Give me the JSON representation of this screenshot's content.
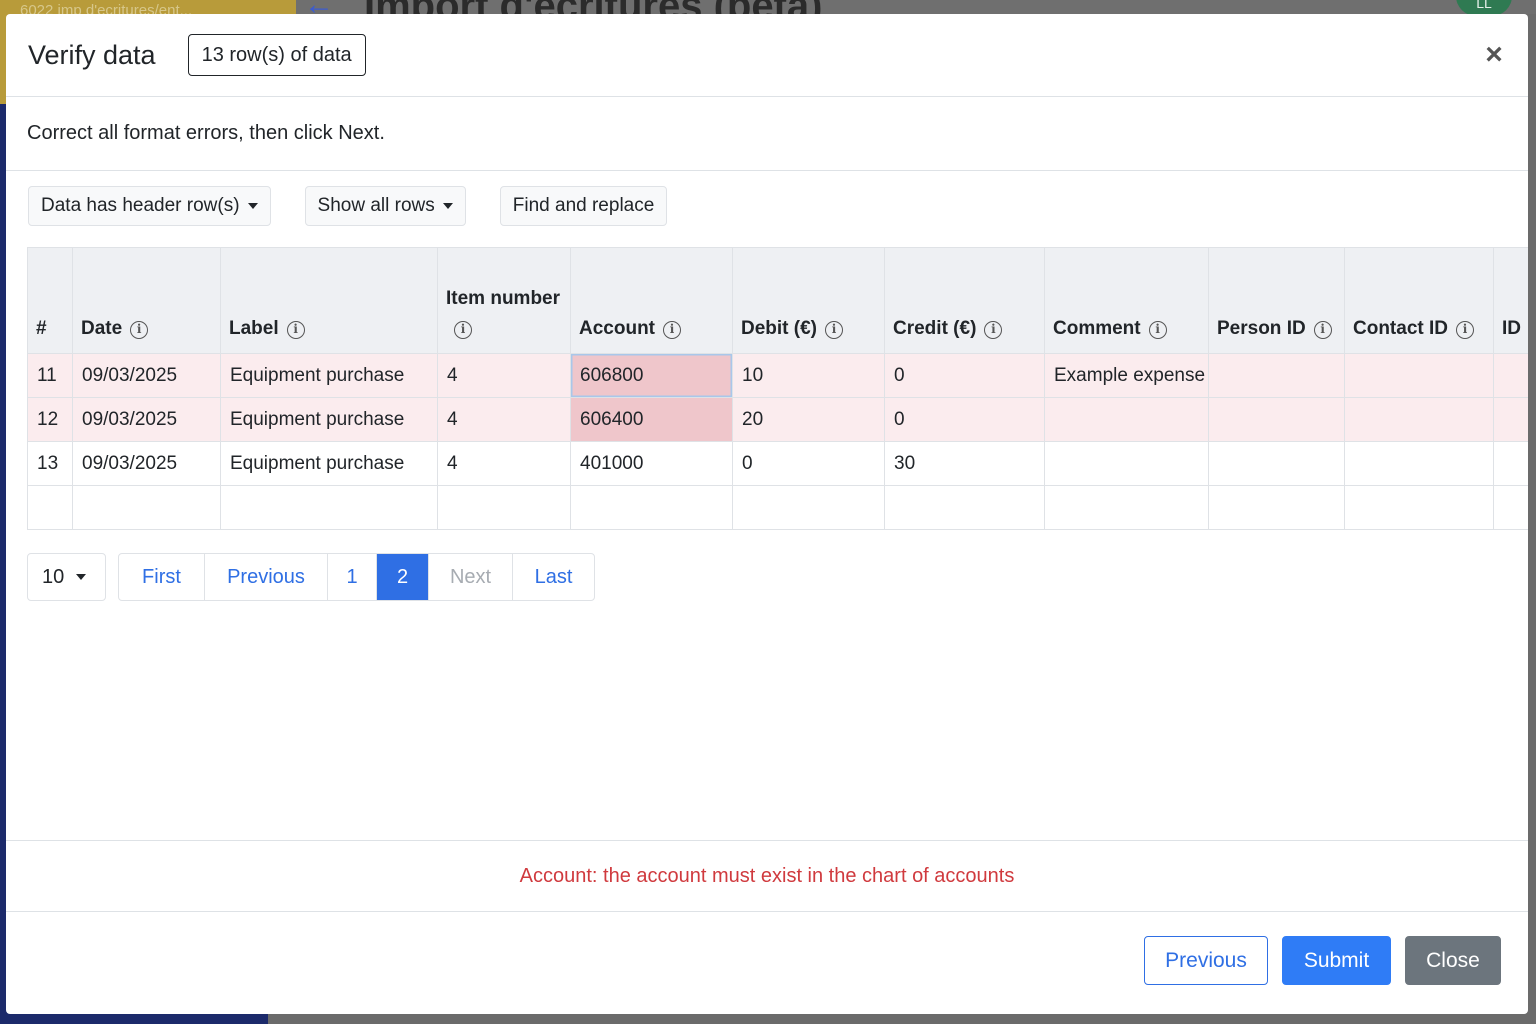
{
  "background": {
    "breadcrumb": "6022 imp d'ecritures/ent...",
    "page_title": "Import d'écritures (beta)",
    "avatar_initials": "LL"
  },
  "modal": {
    "title": "Verify data",
    "row_count_badge": "13 row(s) of data",
    "instruction": "Correct all format errors, then click Next.",
    "toolbar": {
      "header_rows": "Data has header row(s)",
      "row_filter": "Show all rows",
      "find_replace": "Find and replace"
    },
    "table": {
      "columns": [
        {
          "key": "num",
          "label": "#"
        },
        {
          "key": "date",
          "label": "Date"
        },
        {
          "key": "label",
          "label": "Label"
        },
        {
          "key": "item",
          "label": "Item number"
        },
        {
          "key": "account",
          "label": "Account"
        },
        {
          "key": "debit",
          "label": "Debit (€)"
        },
        {
          "key": "credit",
          "label": "Credit (€)"
        },
        {
          "key": "comment",
          "label": "Comment"
        },
        {
          "key": "person",
          "label": "Person ID"
        },
        {
          "key": "contact",
          "label": "Contact ID"
        },
        {
          "key": "id",
          "label": "ID"
        }
      ],
      "rows": [
        {
          "num": "11",
          "date": "09/03/2025",
          "label": "Equipment purchase",
          "item": "4",
          "account": "606800",
          "debit": "10",
          "credit": "0",
          "comment": "Example expense",
          "person": "",
          "contact": "",
          "id": "",
          "has_error": true
        },
        {
          "num": "12",
          "date": "09/03/2025",
          "label": "Equipment purchase",
          "item": "4",
          "account": "606400",
          "debit": "20",
          "credit": "0",
          "comment": "",
          "person": "",
          "contact": "",
          "id": "",
          "has_error": true
        },
        {
          "num": "13",
          "date": "09/03/2025",
          "label": "Equipment purchase",
          "item": "4",
          "account": "401000",
          "debit": "0",
          "credit": "30",
          "comment": "",
          "person": "",
          "contact": "",
          "id": "",
          "has_error": false
        }
      ]
    },
    "pagination": {
      "page_size": "10",
      "first": "First",
      "previous": "Previous",
      "pages": [
        "1",
        "2"
      ],
      "current_page": "2",
      "next": "Next",
      "last": "Last"
    },
    "error_message": "Account: the account must exist in the chart of accounts",
    "footer": {
      "previous": "Previous",
      "submit": "Submit",
      "close": "Close"
    },
    "colors": {
      "primary": "#2f7cf6",
      "error_text": "#d03a3e",
      "error_row": "#fbecee",
      "error_cell": "#efc6cb",
      "secondary": "#6c757d"
    }
  }
}
